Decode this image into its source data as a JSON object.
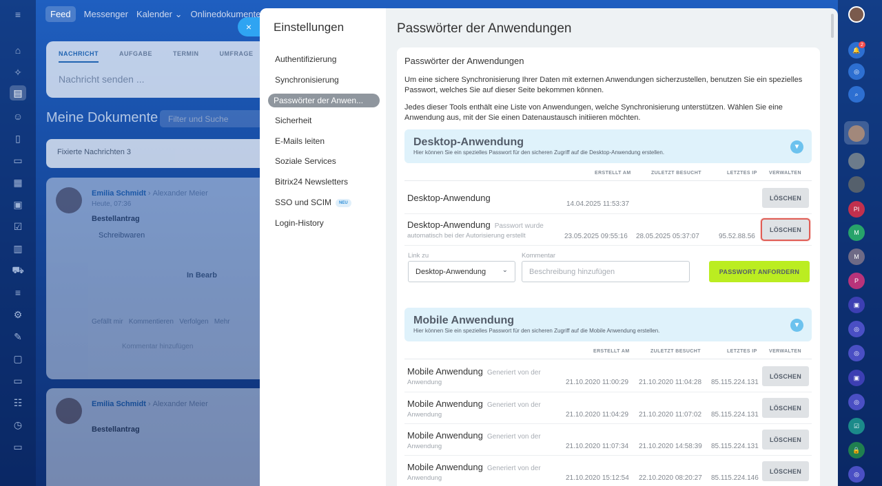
{
  "background": {
    "topnav": [
      "Feed",
      "Messenger",
      "Kalender ⌄",
      "Onlinedokumente"
    ],
    "composer_tabs": [
      "NACHRICHT",
      "AUFGABE",
      "TERMIN",
      "UMFRAGE"
    ],
    "composer_placeholder": "Nachricht senden ...",
    "documents_title": "Meine Dokumente",
    "filter_placeholder": "Filter und Suche",
    "fixed_messages": "Fixierte Nachrichten 3",
    "post1": {
      "author": "Emilia Schmidt",
      "recipient": "Alexander Meier",
      "time": "Heute, 07:36",
      "title": "Bestellantrag",
      "item": "Schreibwaren",
      "status": "In Bearb",
      "actions": "Gefällt mir   Kommentieren   Verfolgen   Mehr",
      "comment_placeholder": "Kommentar hinzufügen"
    },
    "post2": {
      "author": "Emilia Schmidt",
      "recipient": "Alexander Meier",
      "title": "Bestellantrag"
    }
  },
  "close_icon": "×",
  "settings": {
    "title": "Einstellungen",
    "nav": [
      {
        "label": "Authentifizierung"
      },
      {
        "label": "Synchronisierung"
      },
      {
        "label": "Passwörter der Anwen..."
      },
      {
        "label": "Sicherheit"
      },
      {
        "label": "E-Mails leiten"
      },
      {
        "label": "Soziale Services"
      },
      {
        "label": "Bitrix24 Newsletters"
      },
      {
        "label": "SSO und SCIM",
        "badge": "NEU"
      },
      {
        "label": "Login-History"
      }
    ]
  },
  "page": {
    "title": "Passwörter der Anwendungen",
    "card_title": "Passwörter der Anwendungen",
    "para1": "Um eine sichere Synchronisierung Ihrer Daten mit externen Anwendungen sicherzustellen, benutzen Sie ein spezielles Passwort, welches Sie auf dieser Seite bekommen können.",
    "para2": "Jedes dieser Tools enthält eine Liste von Anwendungen, welche Synchronisierung unterstützen. Wählen Sie eine Anwendung aus, mit der Sie einen Datenaustausch initiieren möchten."
  },
  "columns": {
    "created": "ERSTELLT AM",
    "visited": "ZULETZT BESUCHT",
    "ip": "LETZTES IP",
    "manage": "VERWALTEN"
  },
  "desktop": {
    "title": "Desktop-Anwendung",
    "subtitle": "Hier können Sie ein spezielles Passwort für den sicheren Zugriff auf die Desktop-Anwendung erstellen.",
    "rows": [
      {
        "name": "Desktop-Anwendung",
        "note": "",
        "note2": "",
        "created": "14.04.2025 11:53:37",
        "visited": "",
        "ip": "",
        "button": "LÖSCHEN"
      },
      {
        "name": "Desktop-Anwendung",
        "note": "Passwort wurde",
        "note2": "automatisch bei der Autorisierung erstellt",
        "created": "23.05.2025 09:55:16",
        "visited": "28.05.2025 05:37:07",
        "ip": "95.52.88.56",
        "button": "LÖSCHEN"
      }
    ],
    "link_label": "Link zu",
    "link_value": "Desktop-Anwendung",
    "comment_label": "Kommentar",
    "comment_placeholder": "Beschreibung hinzufügen",
    "request_button": "PASSWORT ANFORDERN"
  },
  "mobile": {
    "title": "Mobile Anwendung",
    "subtitle": "Hier können Sie ein spezielles Passwort für den sicheren Zugriff auf die Mobile Anwendung erstellen.",
    "rows": [
      {
        "name": "Mobile Anwendung",
        "note": "Generiert von der",
        "note2": "Anwendung",
        "created": "21.10.2020 11:00:29",
        "visited": "21.10.2020 11:04:28",
        "ip": "85.115.224.131",
        "button": "LÖSCHEN"
      },
      {
        "name": "Mobile Anwendung",
        "note": "Generiert von der",
        "note2": "Anwendung",
        "created": "21.10.2020 11:04:29",
        "visited": "21.10.2020 11:07:02",
        "ip": "85.115.224.131",
        "button": "LÖSCHEN"
      },
      {
        "name": "Mobile Anwendung",
        "note": "Generiert von der",
        "note2": "Anwendung",
        "created": "21.10.2020 11:07:34",
        "visited": "21.10.2020 14:58:39",
        "ip": "85.115.224.131",
        "button": "LÖSCHEN"
      },
      {
        "name": "Mobile Anwendung",
        "note": "Generiert von der",
        "note2": "Anwendung",
        "created": "21.10.2020 15:12:54",
        "visited": "22.10.2020 08:20:27",
        "ip": "85.115.224.146",
        "button": "LÖSCHEN"
      }
    ]
  },
  "right_rail": {
    "notification_count": "2",
    "avatar_initials": [
      "PI",
      "M",
      "M",
      "P"
    ]
  },
  "colors": {
    "accent_blue": "#2067b0",
    "green_button": "#bbed21",
    "highlight": "#e05d55",
    "section_bg": "#dff2fb"
  }
}
